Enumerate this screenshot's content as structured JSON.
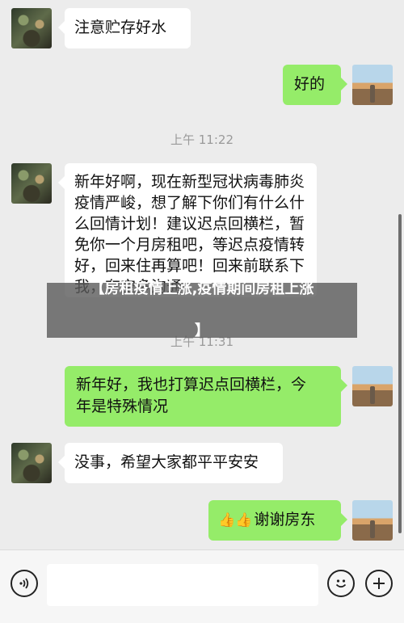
{
  "messages": [
    {
      "side": "left",
      "text": "注意贮存好水"
    },
    {
      "side": "right",
      "text": "好的"
    },
    {
      "type": "time",
      "text": "上午 11:22"
    },
    {
      "side": "left",
      "lines": [
        "新年好啊，现在新型冠状病毒肺炎",
        "疫情严峻，想了解下你们有什么什",
        "么回情计划！建议迟点回横栏，暂",
        "免你一个月房租吧，等迟点疫情转",
        "好，回来住再算吧！回来前联系下",
        "我，有空多沟通"
      ]
    },
    {
      "type": "time",
      "text": "上午 11:31"
    },
    {
      "side": "right",
      "lines": [
        "新年好，我也打算迟点回横栏，今",
        "年是特殊情况"
      ]
    },
    {
      "side": "left",
      "text": "没事，希望大家都平平安安"
    },
    {
      "side": "right",
      "emoji": "👍👍",
      "text": "谢谢房东"
    }
  ],
  "overlay": {
    "title_line1": "【房租疫情上涨,疫情期间房租上涨",
    "title_line2": "】"
  },
  "inputbar": {
    "voice_icon": "voice-icon",
    "emoji_icon": "emoji-icon",
    "plus_icon": "plus-icon",
    "placeholder": ""
  },
  "colors": {
    "right_bubble": "#95ec69",
    "left_bubble": "#ffffff",
    "background": "#ececec"
  }
}
